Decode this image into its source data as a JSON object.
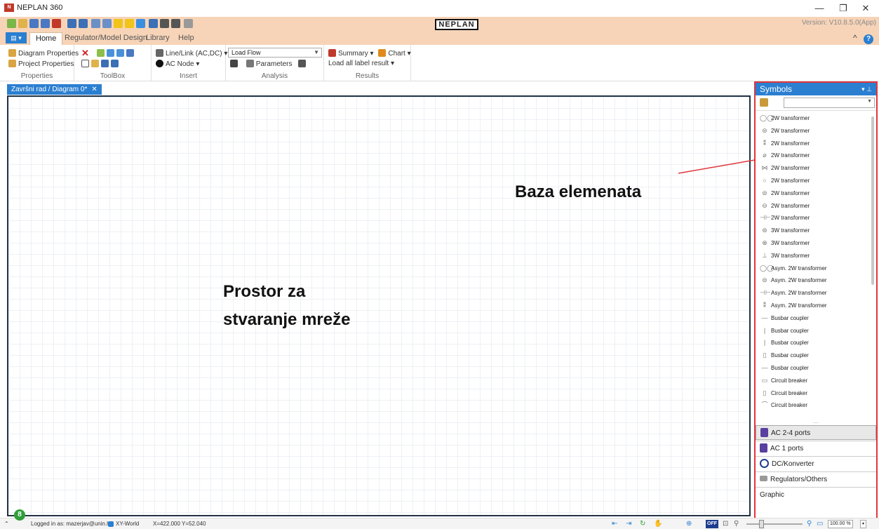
{
  "window": {
    "title": "NEPLAN 360",
    "logo_text": "NEPLAN",
    "version": "Version: V10.8.5.0(App)",
    "minimize": "—",
    "restore": "❐",
    "close": "✕"
  },
  "ribbon_tabs": {
    "file": "▤ ▾",
    "home": "Home",
    "regulator": "Regulator/Model Design",
    "library": "Library",
    "help": "Help",
    "collapse": "^"
  },
  "ribbon": {
    "properties": {
      "diagram": "Diagram Properties",
      "project": "Project Properties",
      "label": "Properties"
    },
    "toolbox": {
      "label": "ToolBox"
    },
    "insert": {
      "line_link": "Line/Link (AC,DC) ▾",
      "ac_node": "AC Node ▾",
      "label": "Insert"
    },
    "analysis": {
      "calc_select": "Load Flow",
      "parameters": "Parameters",
      "label": "Analysis"
    },
    "results": {
      "summary": "Summary ▾",
      "chart": "Chart ▾",
      "load_all": "Load all label result ▾",
      "label": "Results"
    }
  },
  "document_tab": {
    "title": "Završni rad / Diagram 0*",
    "close": "✕"
  },
  "canvas": {
    "annotation_line1": "Prostor za",
    "annotation_line2": "stvaranje mreže",
    "annotation_right": "Baza elemenata"
  },
  "symbols": {
    "title": "Symbols",
    "pin": "▾ ⊥",
    "items": [
      {
        "label": "2W transformer",
        "glyph": "◯◯"
      },
      {
        "label": "2W transformer",
        "glyph": "⊜"
      },
      {
        "label": "2W transformer",
        "glyph": "⁑"
      },
      {
        "label": "2W transformer",
        "glyph": "⌀"
      },
      {
        "label": "2W transformer",
        "glyph": "⋈"
      },
      {
        "label": "2W transformer",
        "glyph": "○"
      },
      {
        "label": "2W transformer",
        "glyph": "⊜"
      },
      {
        "label": "2W transformer",
        "glyph": "⊖"
      },
      {
        "label": "2W transformer",
        "glyph": "⊣⊢"
      },
      {
        "label": "3W transformer",
        "glyph": "⊛"
      },
      {
        "label": "3W transformer",
        "glyph": "⊗"
      },
      {
        "label": "3W transformer",
        "glyph": "⊥"
      },
      {
        "label": "Asym. 2W transformer",
        "glyph": "◯◯"
      },
      {
        "label": "Asym. 2W transformer",
        "glyph": "⊜"
      },
      {
        "label": "Asym. 2W transformer",
        "glyph": "⊣⊢"
      },
      {
        "label": "Asym. 2W transformer",
        "glyph": "⁑"
      },
      {
        "label": "Busbar coupler",
        "glyph": "—"
      },
      {
        "label": "Busbar coupler",
        "glyph": "|"
      },
      {
        "label": "Busbar coupler",
        "glyph": "|"
      },
      {
        "label": "Busbar coupler",
        "glyph": "▯"
      },
      {
        "label": "Busbar coupler",
        "glyph": "—"
      },
      {
        "label": "Circuit breaker",
        "glyph": "▭"
      },
      {
        "label": "Circuit breaker",
        "glyph": "▯"
      },
      {
        "label": "Circuit breaker",
        "glyph": "⌒"
      }
    ],
    "grip": "....",
    "categories": {
      "ac24": "AC 2-4 ports",
      "ac1": "AC 1 ports",
      "dc": "DC/Konverter",
      "regulators": "Regulators/Others",
      "graphic": "Graphic"
    }
  },
  "status": {
    "badge": "8",
    "logged_in": "Logged in as: mazerjav@unin.hr",
    "coord_system": "XY-World",
    "coords": "X=422.000 Y=52.040",
    "zoom": "100.00 %",
    "off": "OFF"
  },
  "colors": {
    "ribbon": "#f7d4b8",
    "accent": "#2b7fd1",
    "highlight": "#e0363c"
  }
}
